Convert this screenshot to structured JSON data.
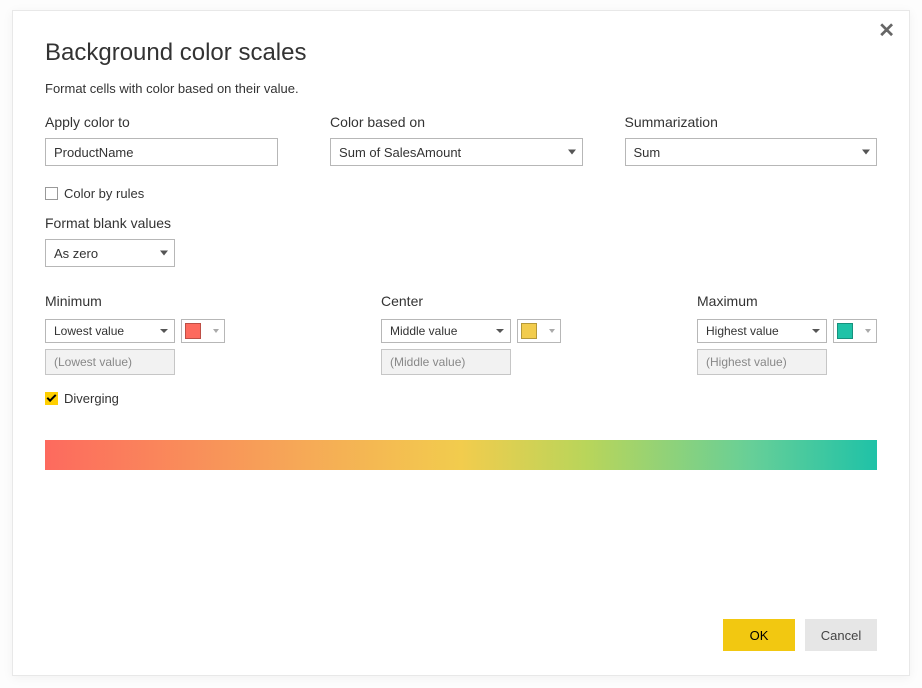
{
  "title": "Background color scales",
  "subtitle": "Format cells with color based on their value.",
  "apply_color_to": {
    "label": "Apply color to",
    "value": "ProductName"
  },
  "color_based_on": {
    "label": "Color based on",
    "value": "Sum of SalesAmount"
  },
  "summarization": {
    "label": "Summarization",
    "value": "Sum"
  },
  "color_by_rules": {
    "label": "Color by rules",
    "checked": false
  },
  "format_blank_values": {
    "label": "Format blank values",
    "value": "As zero"
  },
  "minimum": {
    "label": "Minimum",
    "select_value": "Lowest value",
    "readonly_value": "(Lowest value)",
    "swatch_color": "#fd6a5e"
  },
  "center": {
    "label": "Center",
    "select_value": "Middle value",
    "readonly_value": "(Middle value)",
    "swatch_color": "#f2cc4d"
  },
  "maximum": {
    "label": "Maximum",
    "select_value": "Highest value",
    "readonly_value": "(Highest value)",
    "swatch_color": "#1fc2a7"
  },
  "diverging": {
    "label": "Diverging",
    "checked": true
  },
  "gradient": {
    "start": "#fd6a5e",
    "mid": "#f2cc4d",
    "end": "#1fc2a7"
  },
  "buttons": {
    "ok": "OK",
    "cancel": "Cancel"
  },
  "close_label": "Close"
}
